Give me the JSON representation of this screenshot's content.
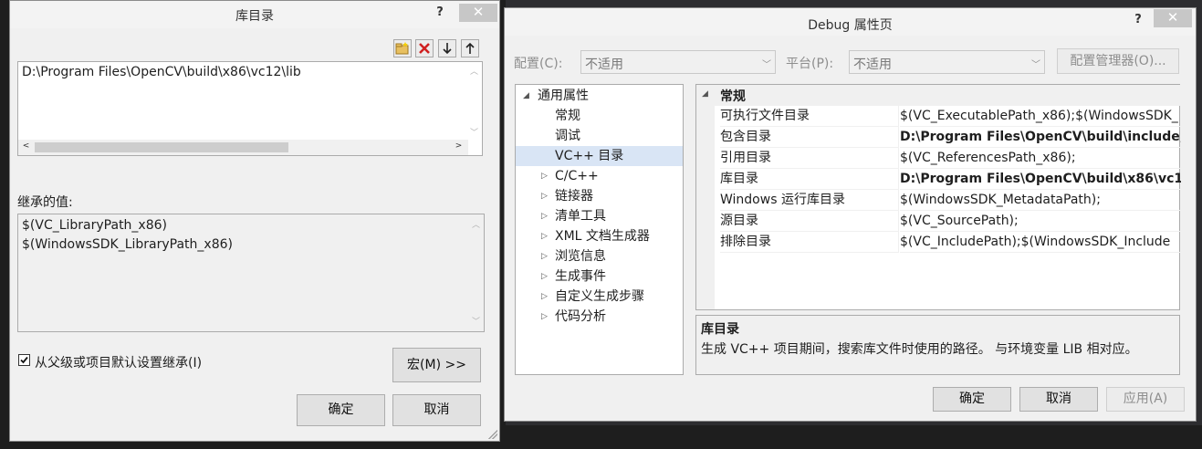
{
  "left_dialog": {
    "title": "库目录",
    "help": "?",
    "close": "✕",
    "path_value": "D:\\Program Files\\OpenCV\\build\\x86\\vc12\\lib",
    "inherited_label": "继承的值:",
    "inherited_values": [
      "$(VC_LibraryPath_x86)",
      "$(WindowsSDK_LibraryPath_x86)"
    ],
    "inherit_checkbox_label": "从父级或项目默认设置继承(I)",
    "macro_button": "宏(M) >>",
    "ok_button": "确定",
    "cancel_button": "取消"
  },
  "right_dialog": {
    "title": "Debug 属性页",
    "help": "?",
    "close": "✕",
    "config_label": "配置(C):",
    "config_value": "不适用",
    "platform_label": "平台(P):",
    "platform_value": "不适用",
    "config_manager_button": "配置管理器(O)...",
    "tree": [
      {
        "label": "通用属性",
        "indent": 0,
        "expander": "◢"
      },
      {
        "label": "常规",
        "indent": 1,
        "expander": ""
      },
      {
        "label": "调试",
        "indent": 1,
        "expander": ""
      },
      {
        "label": "VC++ 目录",
        "indent": 1,
        "expander": "",
        "selected": true
      },
      {
        "label": "C/C++",
        "indent": 1,
        "expander": "▷"
      },
      {
        "label": "链接器",
        "indent": 1,
        "expander": "▷"
      },
      {
        "label": "清单工具",
        "indent": 1,
        "expander": "▷"
      },
      {
        "label": "XML 文档生成器",
        "indent": 1,
        "expander": "▷"
      },
      {
        "label": "浏览信息",
        "indent": 1,
        "expander": "▷"
      },
      {
        "label": "生成事件",
        "indent": 1,
        "expander": "▷"
      },
      {
        "label": "自定义生成步骤",
        "indent": 1,
        "expander": "▷"
      },
      {
        "label": "代码分析",
        "indent": 1,
        "expander": "▷"
      }
    ],
    "grid_category": "常规",
    "grid_rows": [
      {
        "name": "可执行文件目录",
        "value": "$(VC_ExecutablePath_x86);$(WindowsSDK_",
        "bold": false
      },
      {
        "name": "包含目录",
        "value": "D:\\Program Files\\OpenCV\\build\\include;",
        "bold": true
      },
      {
        "name": "引用目录",
        "value": "$(VC_ReferencesPath_x86);",
        "bold": false
      },
      {
        "name": "库目录",
        "value": "D:\\Program Files\\OpenCV\\build\\x86\\vc1",
        "bold": true
      },
      {
        "name": "Windows 运行库目录",
        "value": "$(WindowsSDK_MetadataPath);",
        "bold": false
      },
      {
        "name": "源目录",
        "value": "$(VC_SourcePath);",
        "bold": false
      },
      {
        "name": "排除目录",
        "value": "$(VC_IncludePath);$(WindowsSDK_Include",
        "bold": false
      }
    ],
    "desc_title": "库目录",
    "desc_text": "生成 VC++ 项目期间，搜索库文件时使用的路径。 与环境变量 LIB 相对应。",
    "ok_button": "确定",
    "cancel_button": "取消",
    "apply_button": "应用(A)"
  }
}
